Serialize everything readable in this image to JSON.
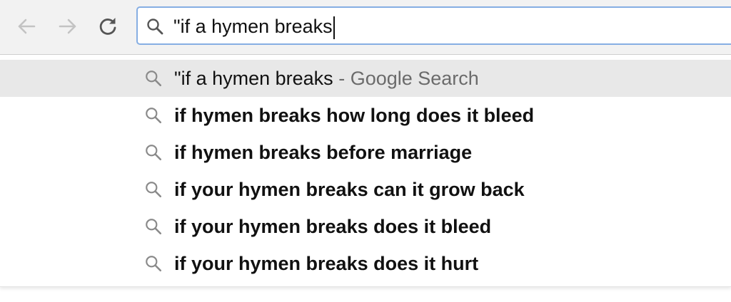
{
  "toolbar": {
    "back_icon": "back-arrow-icon",
    "forward_icon": "forward-arrow-icon",
    "reload_icon": "reload-icon"
  },
  "omnibox": {
    "icon": "search-icon",
    "value": "\"if a hymen breaks"
  },
  "suggestions": {
    "first": {
      "query": "\"if a hymen breaks",
      "separator": " - ",
      "engine": "Google Search"
    },
    "items": [
      "if hymen breaks how long does it bleed",
      "if hymen breaks before marriage",
      "if your hymen breaks can it grow back",
      "if your hymen breaks does it bleed",
      "if your hymen breaks does it hurt"
    ]
  },
  "colors": {
    "toolbar_bg": "#f2f2f2",
    "focus_ring": "#86aee3",
    "highlight_row": "#e8e8e8",
    "icon_gray": "#8a8a8a"
  }
}
